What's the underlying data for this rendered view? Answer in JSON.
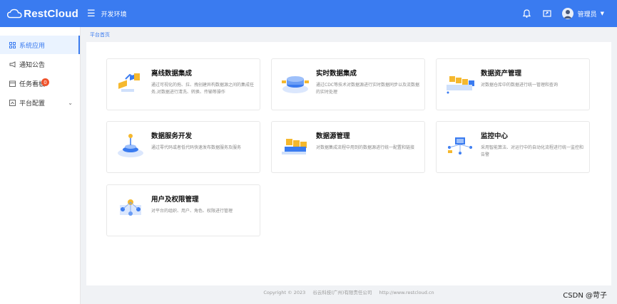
{
  "header": {
    "logo_text": "RestCloud",
    "env_label": "开发环境",
    "user_name": "管理员"
  },
  "sidebar": {
    "items": [
      {
        "label": "系统应用"
      },
      {
        "label": "通知公告"
      },
      {
        "label": "任务看板",
        "badge": "0"
      },
      {
        "label": "平台配置"
      }
    ]
  },
  "breadcrumb": "平台首页",
  "cards": [
    {
      "title": "离线数据集成",
      "desc": "通过可视化的拖、拉、拽创建异构数据源之间的集成任务,对数据进行清洗、转换、传输等操作"
    },
    {
      "title": "实时数据集成",
      "desc": "通过CDC等技术对数据源进行实时数据同步以及流数据的实时处理"
    },
    {
      "title": "数据资产管理",
      "desc": "对数据仓库中的数据进行统一管理和查询"
    },
    {
      "title": "数据服务开发",
      "desc": "通过零代码或者低代码快速发布数据服务及服务"
    },
    {
      "title": "数据源管理",
      "desc": "对数据集成流程中用到的数据源进行统一配置和链接"
    },
    {
      "title": "监控中心",
      "desc": "采用智能算法、对运行中的自动化流程进行统一监控和告警"
    },
    {
      "title": "用户及权限管理",
      "desc": "对平台的组织、用户、角色、权限进行管理"
    }
  ],
  "footer": {
    "copyright": "Copyright © 2023",
    "company": "谷云科技(广州)有限责任公司",
    "url": "http://www.restcloud.cn"
  },
  "watermark": "CSDN @苛子"
}
